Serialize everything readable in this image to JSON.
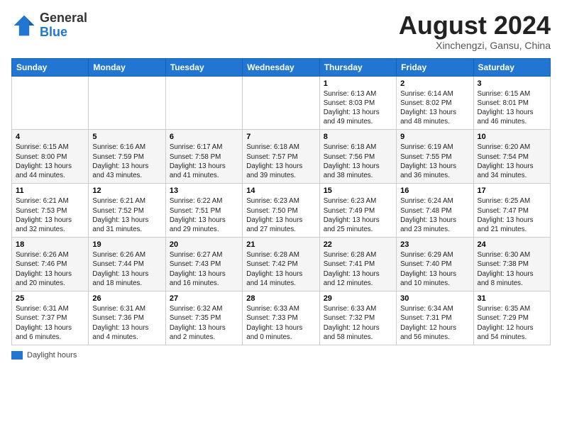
{
  "header": {
    "logo_general": "General",
    "logo_blue": "Blue",
    "month_year": "August 2024",
    "location": "Xinchengzi, Gansu, China"
  },
  "days_of_week": [
    "Sunday",
    "Monday",
    "Tuesday",
    "Wednesday",
    "Thursday",
    "Friday",
    "Saturday"
  ],
  "legend": {
    "label": "Daylight hours"
  },
  "weeks": [
    [
      {
        "day": "",
        "info": ""
      },
      {
        "day": "",
        "info": ""
      },
      {
        "day": "",
        "info": ""
      },
      {
        "day": "",
        "info": ""
      },
      {
        "day": "1",
        "info": "Sunrise: 6:13 AM\nSunset: 8:03 PM\nDaylight: 13 hours and 49 minutes."
      },
      {
        "day": "2",
        "info": "Sunrise: 6:14 AM\nSunset: 8:02 PM\nDaylight: 13 hours and 48 minutes."
      },
      {
        "day": "3",
        "info": "Sunrise: 6:15 AM\nSunset: 8:01 PM\nDaylight: 13 hours and 46 minutes."
      }
    ],
    [
      {
        "day": "4",
        "info": "Sunrise: 6:15 AM\nSunset: 8:00 PM\nDaylight: 13 hours and 44 minutes."
      },
      {
        "day": "5",
        "info": "Sunrise: 6:16 AM\nSunset: 7:59 PM\nDaylight: 13 hours and 43 minutes."
      },
      {
        "day": "6",
        "info": "Sunrise: 6:17 AM\nSunset: 7:58 PM\nDaylight: 13 hours and 41 minutes."
      },
      {
        "day": "7",
        "info": "Sunrise: 6:18 AM\nSunset: 7:57 PM\nDaylight: 13 hours and 39 minutes."
      },
      {
        "day": "8",
        "info": "Sunrise: 6:18 AM\nSunset: 7:56 PM\nDaylight: 13 hours and 38 minutes."
      },
      {
        "day": "9",
        "info": "Sunrise: 6:19 AM\nSunset: 7:55 PM\nDaylight: 13 hours and 36 minutes."
      },
      {
        "day": "10",
        "info": "Sunrise: 6:20 AM\nSunset: 7:54 PM\nDaylight: 13 hours and 34 minutes."
      }
    ],
    [
      {
        "day": "11",
        "info": "Sunrise: 6:21 AM\nSunset: 7:53 PM\nDaylight: 13 hours and 32 minutes."
      },
      {
        "day": "12",
        "info": "Sunrise: 6:21 AM\nSunset: 7:52 PM\nDaylight: 13 hours and 31 minutes."
      },
      {
        "day": "13",
        "info": "Sunrise: 6:22 AM\nSunset: 7:51 PM\nDaylight: 13 hours and 29 minutes."
      },
      {
        "day": "14",
        "info": "Sunrise: 6:23 AM\nSunset: 7:50 PM\nDaylight: 13 hours and 27 minutes."
      },
      {
        "day": "15",
        "info": "Sunrise: 6:23 AM\nSunset: 7:49 PM\nDaylight: 13 hours and 25 minutes."
      },
      {
        "day": "16",
        "info": "Sunrise: 6:24 AM\nSunset: 7:48 PM\nDaylight: 13 hours and 23 minutes."
      },
      {
        "day": "17",
        "info": "Sunrise: 6:25 AM\nSunset: 7:47 PM\nDaylight: 13 hours and 21 minutes."
      }
    ],
    [
      {
        "day": "18",
        "info": "Sunrise: 6:26 AM\nSunset: 7:46 PM\nDaylight: 13 hours and 20 minutes."
      },
      {
        "day": "19",
        "info": "Sunrise: 6:26 AM\nSunset: 7:44 PM\nDaylight: 13 hours and 18 minutes."
      },
      {
        "day": "20",
        "info": "Sunrise: 6:27 AM\nSunset: 7:43 PM\nDaylight: 13 hours and 16 minutes."
      },
      {
        "day": "21",
        "info": "Sunrise: 6:28 AM\nSunset: 7:42 PM\nDaylight: 13 hours and 14 minutes."
      },
      {
        "day": "22",
        "info": "Sunrise: 6:28 AM\nSunset: 7:41 PM\nDaylight: 13 hours and 12 minutes."
      },
      {
        "day": "23",
        "info": "Sunrise: 6:29 AM\nSunset: 7:40 PM\nDaylight: 13 hours and 10 minutes."
      },
      {
        "day": "24",
        "info": "Sunrise: 6:30 AM\nSunset: 7:38 PM\nDaylight: 13 hours and 8 minutes."
      }
    ],
    [
      {
        "day": "25",
        "info": "Sunrise: 6:31 AM\nSunset: 7:37 PM\nDaylight: 13 hours and 6 minutes."
      },
      {
        "day": "26",
        "info": "Sunrise: 6:31 AM\nSunset: 7:36 PM\nDaylight: 13 hours and 4 minutes."
      },
      {
        "day": "27",
        "info": "Sunrise: 6:32 AM\nSunset: 7:35 PM\nDaylight: 13 hours and 2 minutes."
      },
      {
        "day": "28",
        "info": "Sunrise: 6:33 AM\nSunset: 7:33 PM\nDaylight: 13 hours and 0 minutes."
      },
      {
        "day": "29",
        "info": "Sunrise: 6:33 AM\nSunset: 7:32 PM\nDaylight: 12 hours and 58 minutes."
      },
      {
        "day": "30",
        "info": "Sunrise: 6:34 AM\nSunset: 7:31 PM\nDaylight: 12 hours and 56 minutes."
      },
      {
        "day": "31",
        "info": "Sunrise: 6:35 AM\nSunset: 7:29 PM\nDaylight: 12 hours and 54 minutes."
      }
    ]
  ]
}
